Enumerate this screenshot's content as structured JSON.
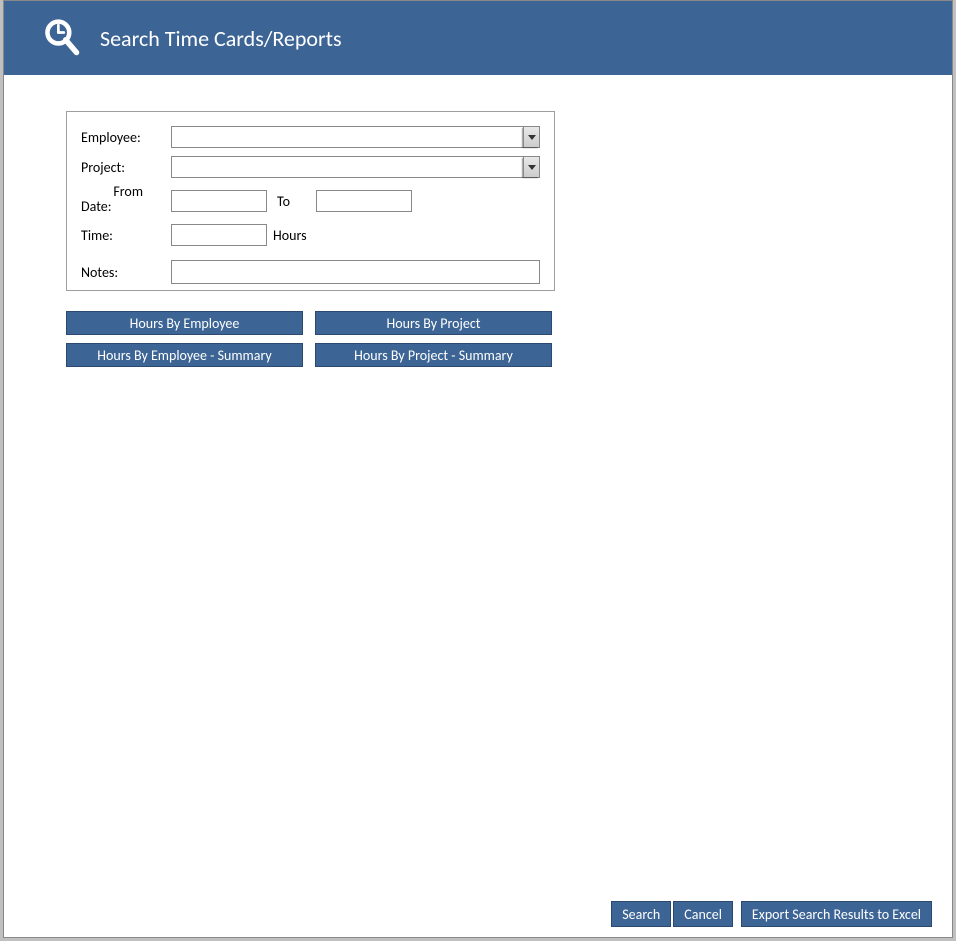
{
  "header": {
    "title": "Search Time Cards/Reports"
  },
  "form": {
    "employee_label": "Employee:",
    "employee_value": "",
    "project_label": "Project:",
    "project_value": "",
    "from_date_label_top": "From",
    "from_date_label_bottom": "Date:",
    "from_date_value": "",
    "to_label": "To",
    "to_date_value": "",
    "time_label": "Time:",
    "time_value": "",
    "time_unit": "Hours",
    "notes_label": "Notes:",
    "notes_value": ""
  },
  "report_buttons": {
    "row1": [
      "Hours By Employee",
      "Hours By Project"
    ],
    "row2": [
      "Hours By Employee - Summary",
      "Hours By Project - Summary"
    ]
  },
  "footer": {
    "search": "Search",
    "cancel": "Cancel",
    "export": "Export Search Results to Excel"
  }
}
